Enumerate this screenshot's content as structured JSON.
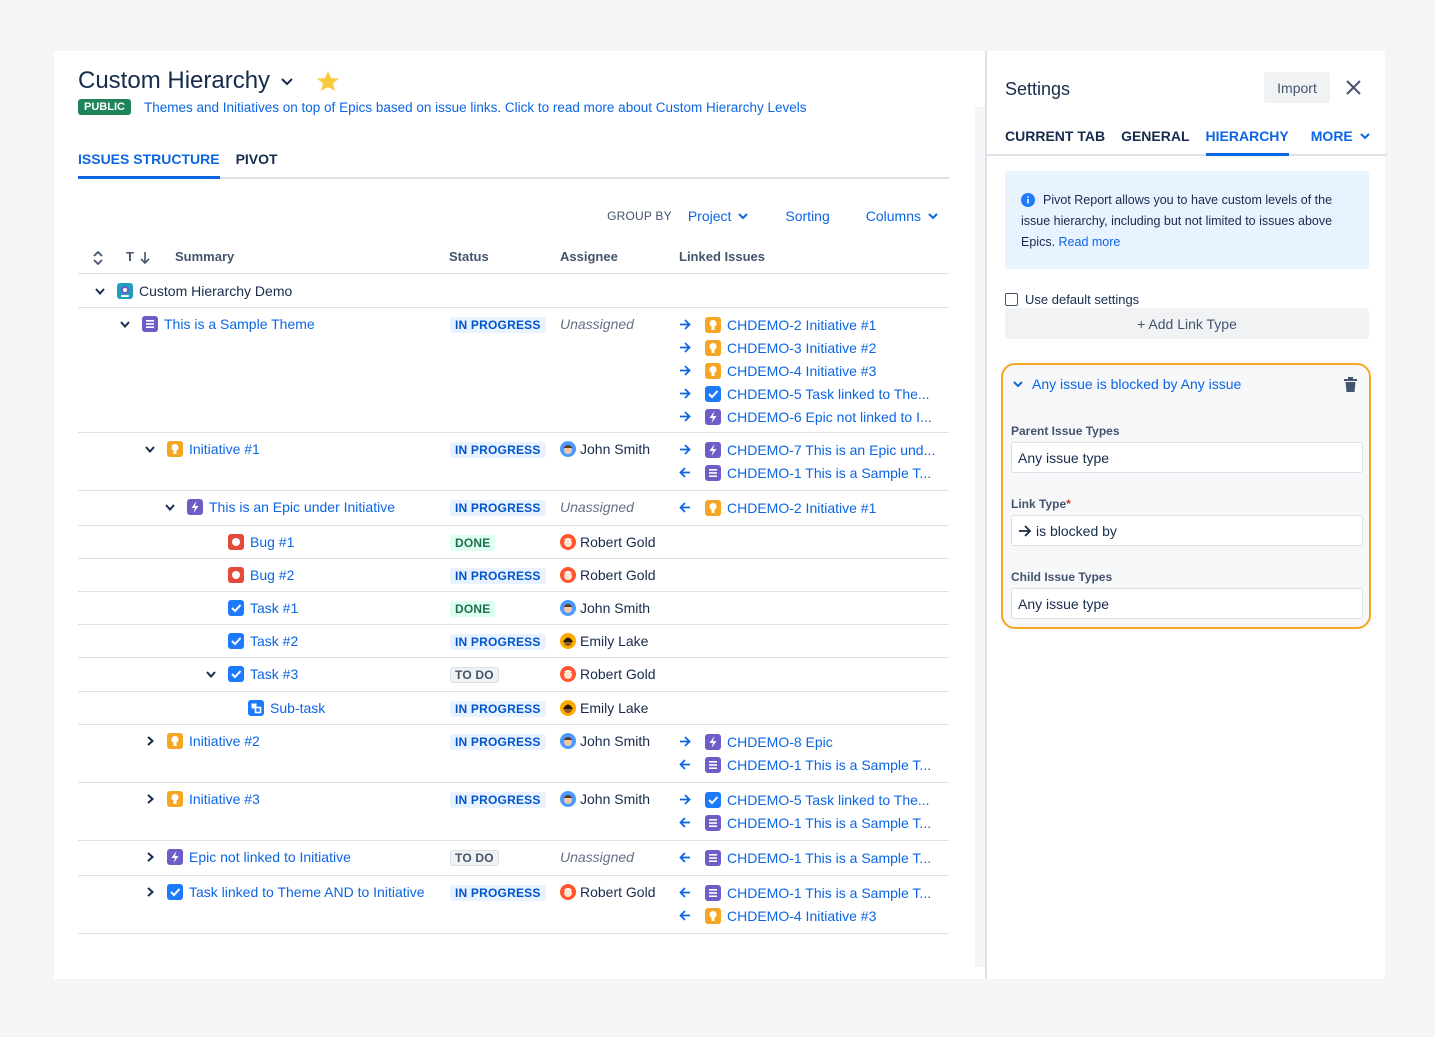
{
  "header": {
    "title": "Custom Hierarchy",
    "badge": "PUBLIC",
    "description": "Themes and Initiatives on top of Epics based on issue links. Click to read more about Custom Hierarchy Levels"
  },
  "tabs": [
    "ISSUES STRUCTURE",
    "PIVOT"
  ],
  "toolbar": {
    "group_by_label": "GROUP BY",
    "group_by_value": "Project",
    "sorting": "Sorting",
    "columns": "Columns"
  },
  "table": {
    "columns": {
      "type": "T",
      "summary": "Summary",
      "status": "Status",
      "assignee": "Assignee",
      "linked": "Linked Issues"
    },
    "rows": [
      {
        "summary": "Custom Hierarchy Demo",
        "status": "",
        "assignee": "",
        "links": []
      },
      {
        "summary": "This is a Sample Theme",
        "status": "IN PROGRESS",
        "assignee": "Unassigned",
        "links": [
          "CHDEMO-2 Initiative #1",
          "CHDEMO-3 Initiative #2",
          "CHDEMO-4 Initiative #3",
          "CHDEMO-5 Task linked to The...",
          "CHDEMO-6 Epic not linked to I..."
        ]
      },
      {
        "summary": "Initiative #1",
        "status": "IN PROGRESS",
        "assignee": "John Smith",
        "links": [
          "CHDEMO-7 This is an Epic und...",
          "CHDEMO-1 This is a Sample T..."
        ]
      },
      {
        "summary": "This is an Epic under Initiative",
        "status": "IN PROGRESS",
        "assignee": "Unassigned",
        "links": [
          "CHDEMO-2 Initiative #1"
        ]
      },
      {
        "summary": "Bug #1",
        "status": "DONE",
        "assignee": "Robert Gold",
        "links": []
      },
      {
        "summary": "Bug #2",
        "status": "IN PROGRESS",
        "assignee": "Robert Gold",
        "links": []
      },
      {
        "summary": "Task #1",
        "status": "DONE",
        "assignee": "John Smith",
        "links": []
      },
      {
        "summary": "Task #2",
        "status": "IN PROGRESS",
        "assignee": "Emily Lake",
        "links": []
      },
      {
        "summary": "Task #3",
        "status": "TO DO",
        "assignee": "Robert Gold",
        "links": []
      },
      {
        "summary": "Sub-task",
        "status": "IN PROGRESS",
        "assignee": "Emily Lake",
        "links": []
      },
      {
        "summary": "Initiative #2",
        "status": "IN PROGRESS",
        "assignee": "John Smith",
        "links": [
          "CHDEMO-8 Epic",
          "CHDEMO-1 This is a Sample T..."
        ]
      },
      {
        "summary": "Initiative #3",
        "status": "IN PROGRESS",
        "assignee": "John Smith",
        "links": [
          "CHDEMO-5 Task linked to The...",
          "CHDEMO-1 This is a Sample T..."
        ]
      },
      {
        "summary": "Epic not linked to Initiative",
        "status": "TO DO",
        "assignee": "Unassigned",
        "links": [
          "CHDEMO-1 This is a Sample T..."
        ]
      },
      {
        "summary": "Task linked to Theme AND to Initiative",
        "status": "IN PROGRESS",
        "assignee": "Robert Gold",
        "links": [
          "CHDEMO-1 This is a Sample T...",
          "CHDEMO-4 Initiative #3"
        ]
      }
    ]
  },
  "settings": {
    "title": "Settings",
    "import": "Import",
    "tabs": [
      "CURRENT TAB",
      "GENERAL",
      "HIERARCHY",
      "MORE"
    ],
    "info_text": "Pivot Report allows you to have custom levels of the issue hierarchy, including but not limited to issues above Epics.",
    "info_link": "Read more",
    "use_default": "Use default settings",
    "add_link_type": "+ Add Link Type",
    "rule": {
      "title": "Any issue is blocked by Any issue",
      "parent_label": "Parent Issue Types",
      "parent_value": "Any issue type",
      "link_label": "Link Type",
      "link_required": "*",
      "link_value": "is blocked by",
      "child_label": "Child Issue Types",
      "child_value": "Any issue type"
    }
  },
  "colors": {
    "accent": "#0c66e4",
    "highlight_border": "#f5a623",
    "public_badge": "#1f845a"
  }
}
